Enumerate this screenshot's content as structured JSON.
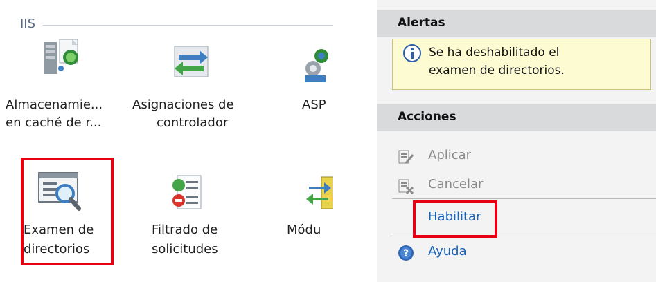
{
  "features": {
    "group_label": "IIS",
    "tiles": [
      {
        "line1": "Almacenamie...",
        "line2": "en caché de r..."
      },
      {
        "line1": "Asignaciones de",
        "line2": "controlador"
      },
      {
        "line1": "ASP",
        "line2": ""
      },
      {
        "line1": "Examen de",
        "line2": "directorios"
      },
      {
        "line1": "Filtrado de",
        "line2": "solicitudes"
      },
      {
        "line1": "Módu",
        "line2": ""
      }
    ]
  },
  "panel": {
    "alerts_header": "Alertas",
    "alert_line1": "Se ha deshabilitado el",
    "alert_line2": "examen de directorios.",
    "actions_header": "Acciones",
    "actions": {
      "apply": "Aplicar",
      "cancel": "Cancelar",
      "enable": "Habilitar",
      "help": "Ayuda"
    }
  },
  "colors": {
    "highlight": "#e60012",
    "link": "#1a64b8",
    "disabled": "#8a8a8a"
  }
}
